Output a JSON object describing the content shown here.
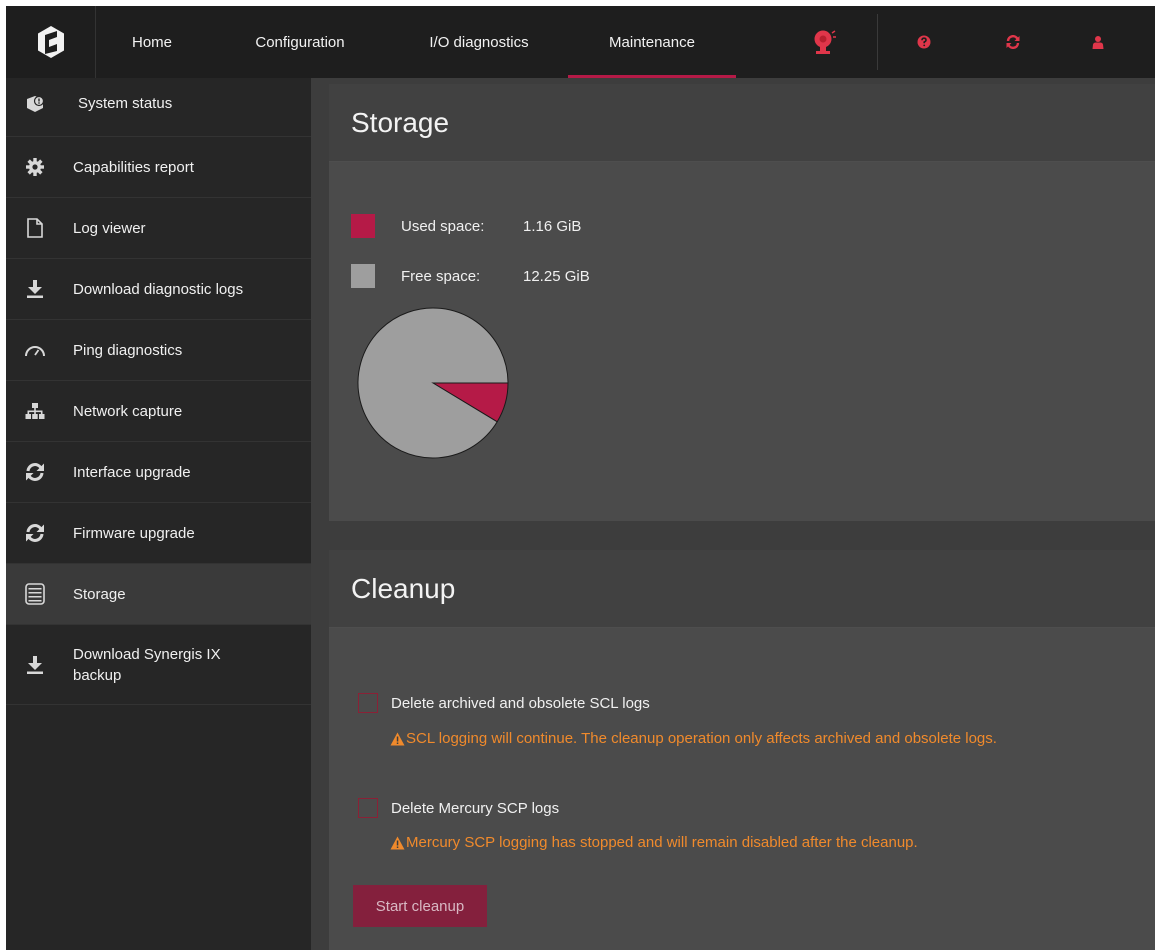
{
  "nav": {
    "items": [
      {
        "label": "Home"
      },
      {
        "label": "Configuration"
      },
      {
        "label": "I/O diagnostics"
      },
      {
        "label": "Maintenance"
      }
    ],
    "active_index": 3,
    "icons": [
      "alarm-bell-icon",
      "help-icon",
      "refresh-icon",
      "user-icon"
    ]
  },
  "sidebar": {
    "items": [
      {
        "label": "System status",
        "icon": "system-status-icon"
      },
      {
        "label": "Capabilities report",
        "icon": "gear-icon"
      },
      {
        "label": "Log viewer",
        "icon": "file-icon"
      },
      {
        "label": "Download diagnostic logs",
        "icon": "download-icon"
      },
      {
        "label": "Ping diagnostics",
        "icon": "gauge-icon"
      },
      {
        "label": "Network capture",
        "icon": "network-icon"
      },
      {
        "label": "Interface upgrade",
        "icon": "refresh-icon"
      },
      {
        "label": "Firmware upgrade",
        "icon": "refresh-icon"
      },
      {
        "label": "Storage",
        "icon": "storage-icon"
      },
      {
        "label": "Download Synergis IX backup",
        "icon": "download-icon"
      }
    ],
    "active_index": 8
  },
  "storage": {
    "title": "Storage",
    "used_label": "Used space:",
    "used_value": "1.16 GiB",
    "free_label": "Free space:",
    "free_value": "12.25 GiB",
    "used_color": "#b51a47",
    "free_color": "#9e9e9e"
  },
  "chart_data": {
    "type": "pie",
    "slices": [
      {
        "label": "Used space",
        "value": 1.16,
        "color": "#b51a47"
      },
      {
        "label": "Free space",
        "value": 12.25,
        "color": "#9e9e9e"
      }
    ]
  },
  "cleanup": {
    "title": "Cleanup",
    "option1_label": "Delete archived and obsolete SCL logs",
    "option1_warning": "SCL logging will continue. The cleanup operation only affects archived and obsolete logs.",
    "option2_label": "Delete Mercury SCP logs",
    "option2_warning": "Mercury SCP logging has stopped and will remain disabled after the cleanup.",
    "button_label": "Start cleanup"
  },
  "colors": {
    "accent": "#b51a47",
    "warning": "#f08a2c",
    "topbar_icon": "#e0364a"
  }
}
